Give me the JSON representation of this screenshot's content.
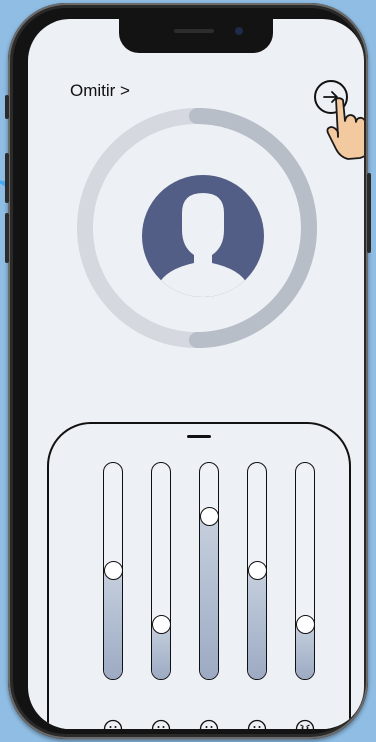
{
  "header": {
    "skip_label": "Omitir >"
  },
  "colors": {
    "background": "#8fbde4",
    "screen": "#edf0f4",
    "avatar": "#525e86",
    "slider_fill": "#9caac3"
  },
  "icons": [
    "next-arrow-icon",
    "tap-hand-icon",
    "user-avatar-icon"
  ],
  "progress_ring": {
    "value": 0.5
  },
  "sliders": [
    {
      "name": "happy",
      "icon": "smile-face-icon",
      "value": 0.5
    },
    {
      "name": "anxious",
      "icon": "wavy-mouth-face-icon",
      "value": 0.25
    },
    {
      "name": "neutral",
      "icon": "neutral-face-icon",
      "value": 0.75
    },
    {
      "name": "confused",
      "icon": "confused-face-icon",
      "value": 0.5
    },
    {
      "name": "angry",
      "icon": "angry-face-icon",
      "value": 0.25
    }
  ]
}
